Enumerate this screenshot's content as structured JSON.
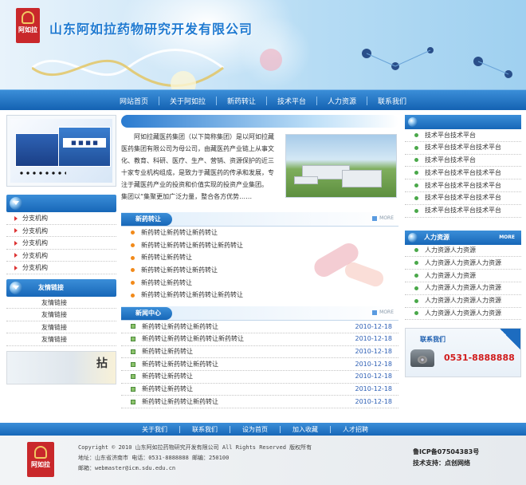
{
  "logo": {
    "text": "阿如拉"
  },
  "header": {
    "company_name": "山东阿如拉药物研究开发有限公司"
  },
  "nav": {
    "items": [
      "网站首页",
      "关于阿如拉",
      "新药转让",
      "技术平台",
      "人力资源",
      "联系我们"
    ]
  },
  "left": {
    "branch_title": "",
    "branch_items": [
      "分支机构",
      "分支机构",
      "分支机构",
      "分支机构",
      "分支机构"
    ],
    "friends_title": "友情链接",
    "friend_items": [
      "友情链接",
      "友情链接",
      "友情链接",
      "友情链接"
    ],
    "banner_char": "拈"
  },
  "intro": {
    "text": "阿如拉藏医药集团（以下简称集团）是以阿如拉藏医药集团有限公司为母公司，由藏医药产业链上从事文化、教育、科研、医疗、生产、营销、资源保护的近三十家专业机构组成，是致力于藏医药的传承和发展，专注于藏医药产业的投资和价值实现的投资产业集团。",
    "text2": "集团以“集聚更加广泛力量，整合各方优势……"
  },
  "transfer": {
    "title": "新药转让",
    "more": "MORE",
    "items": [
      "新药转让新药转让新药转让",
      "新药转让新药转让新药转让新药转让",
      "新药转让新药转让",
      "新药转让新药转让新药转让",
      "新药转让新药转让",
      "新药转让新药转让新药转让新药转让"
    ]
  },
  "news": {
    "title": "新闻中心",
    "more": "MORE",
    "items": [
      {
        "title": "新药转让新药转让新药转让",
        "date": "2010-12-18"
      },
      {
        "title": "新药转让新药转让新药转让新药转让",
        "date": "2010-12-18"
      },
      {
        "title": "新药转让新药转让",
        "date": "2010-12-18"
      },
      {
        "title": "新药转让新药转让新药转让",
        "date": "2010-12-18"
      },
      {
        "title": "新药转让新药转让",
        "date": "2010-12-18"
      },
      {
        "title": "新药转让新药转让",
        "date": "2010-12-18"
      },
      {
        "title": "新药转让新药转让新药转让",
        "date": "2010-12-18"
      }
    ]
  },
  "tech": {
    "items": [
      "技术平台技术平台",
      "技术平台技术平台技术平台",
      "技术平台技术平台",
      "技术平台技术平台技术平台",
      "技术平台技术平台技术平台",
      "技术平台技术平台技术平台",
      "技术平台技术平台技术平台"
    ]
  },
  "hr": {
    "title": "人力资源",
    "more": "MORE",
    "items": [
      "人力资源人力资源",
      "人力资源人力资源人力资源",
      "人力资源人力资源",
      "人力资源人力资源人力资源",
      "人力资源人力资源人力资源",
      "人力资源人力资源人力资源"
    ]
  },
  "contact": {
    "title": "联系我们",
    "phone": "0531-8888888"
  },
  "footer_nav": {
    "items": [
      "关于我们",
      "联系我们",
      "设为首页",
      "加入收藏",
      "人才招聘"
    ]
  },
  "footer": {
    "copyright": "Copyright © 2010 山东阿如拉药物研究开发有限公司 All Rights Reserved 版权所有",
    "address": "地址：山东省济南市   电话：0531-8888888   邮编：250100",
    "email": "邮箱：webmaster@icm.sdu.edu.cn",
    "icp": "鲁ICP备07504383号",
    "support": "技术支持：点创网络"
  },
  "colors": {
    "primary": "#1767b8",
    "accent_red": "#c9282b",
    "phone_red": "#d11c1c",
    "date_blue": "#2d5fb5"
  }
}
